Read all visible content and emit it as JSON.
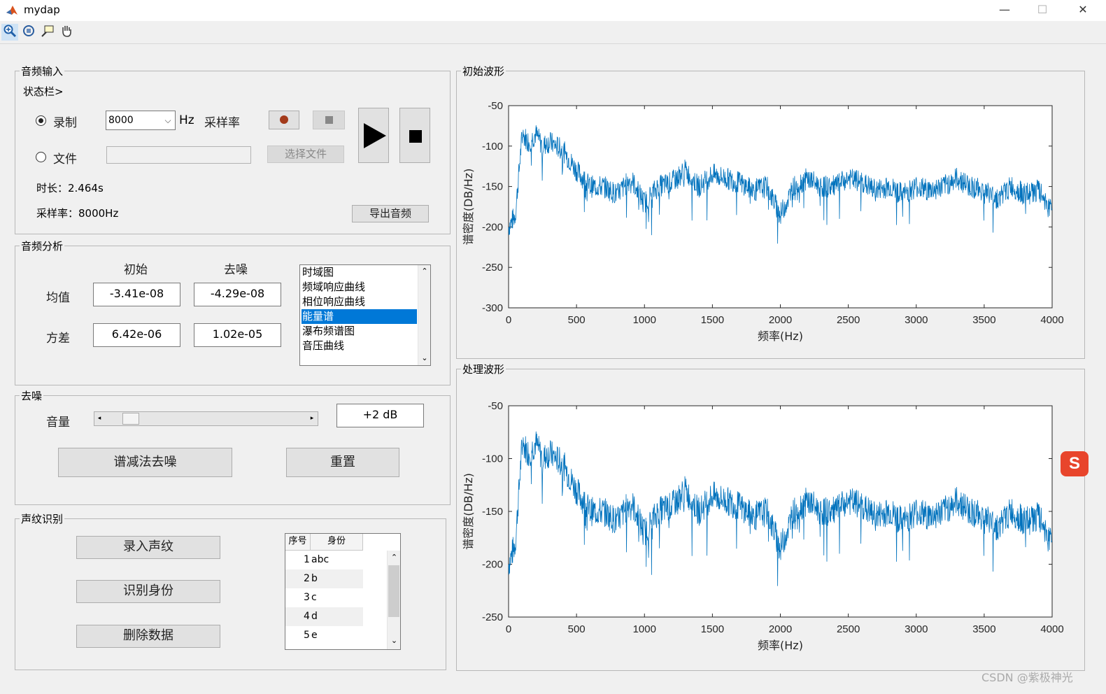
{
  "window": {
    "title": "mydap",
    "minimize_glyph": "—",
    "maximize_glyph": "☐",
    "close_glyph": "✕"
  },
  "toolbar": {
    "icons": [
      "zoom-in-icon",
      "rotate-icon",
      "data-cursor-icon",
      "pan-hand-icon"
    ]
  },
  "audio_input": {
    "title": "音频输入",
    "status": "状态栏>",
    "record_label": "录制",
    "sample_rate_value": "8000",
    "hz": "Hz",
    "sample_rate_label": "采样率",
    "file_label": "文件",
    "file_path_value": "",
    "choose_file": "选择文件",
    "duration": "时长：2.464s",
    "sample_rate_info": "采样率：8000Hz",
    "export": "导出音频"
  },
  "analysis": {
    "title": "音频分析",
    "col_initial": "初始",
    "col_denoised": "去噪",
    "row_mean": "均值",
    "row_variance": "方差",
    "mean_initial": "-3.41e-08",
    "mean_denoised": "-4.29e-08",
    "var_initial": "6.42e-06",
    "var_denoised": "1.02e-05",
    "plot_types": [
      "时域图",
      "频域响应曲线",
      "相位响应曲线",
      "能量谱",
      "瀑布频谱图",
      "音压曲线"
    ],
    "selected_plot_type": "能量谱"
  },
  "denoise": {
    "title": "去噪",
    "volume_label": "音量",
    "volume_level": 0.1,
    "volume_value": "+2 dB",
    "spectral_subtraction": "谱减法去噪",
    "reset": "重置"
  },
  "voiceprint": {
    "title": "声纹识别",
    "enroll": "录入声纹",
    "identify": "识别身份",
    "delete": "删除数据",
    "table_headers": [
      "序号",
      "身份"
    ],
    "rows": [
      {
        "id": "1",
        "name": "abc"
      },
      {
        "id": "2",
        "name": "b"
      },
      {
        "id": "3",
        "name": "c"
      },
      {
        "id": "4",
        "name": "d"
      },
      {
        "id": "5",
        "name": "e"
      }
    ]
  },
  "watermark": "CSDN @紫极神光",
  "chart_data": [
    {
      "type": "line",
      "panel_title": "初始波形",
      "xlabel": "频率(Hz)",
      "ylabel": "谱密度(DB/Hz)",
      "xlim": [
        0,
        4000
      ],
      "ylim": [
        -300,
        -50
      ],
      "x_ticks": [
        0,
        500,
        1000,
        1500,
        2000,
        2500,
        3000,
        3500,
        4000
      ],
      "y_ticks": [
        -50,
        -100,
        -150,
        -200,
        -250,
        -300
      ],
      "color": "#0072bd",
      "series": [
        {
          "x": [
            0,
            50,
            100,
            150,
            200,
            250,
            300,
            400,
            500,
            600,
            700,
            800,
            900,
            1000,
            1100,
            1200,
            1300,
            1400,
            1500,
            1600,
            1700,
            1800,
            1900,
            2000,
            2100,
            2200,
            2300,
            2400,
            2500,
            2600,
            2700,
            2800,
            2900,
            3000,
            3100,
            3200,
            3300,
            3400,
            3500,
            3600,
            3700,
            3800,
            3900,
            4000
          ],
          "values": [
            -200,
            -185,
            -85,
            -95,
            -85,
            -100,
            -95,
            -105,
            -130,
            -150,
            -150,
            -160,
            -140,
            -170,
            -150,
            -145,
            -130,
            -150,
            -135,
            -140,
            -145,
            -155,
            -150,
            -185,
            -150,
            -140,
            -150,
            -150,
            -140,
            -145,
            -155,
            -150,
            -160,
            -150,
            -155,
            -150,
            -140,
            -150,
            -155,
            -165,
            -150,
            -160,
            -155,
            -180
          ]
        }
      ]
    },
    {
      "type": "line",
      "panel_title": "处理波形",
      "xlabel": "频率(Hz)",
      "ylabel": "谱密度(DB/Hz)",
      "xlim": [
        0,
        4000
      ],
      "ylim": [
        -250,
        -50
      ],
      "x_ticks": [
        0,
        500,
        1000,
        1500,
        2000,
        2500,
        3000,
        3500,
        4000
      ],
      "y_ticks": [
        -50,
        -100,
        -150,
        -200,
        -250
      ],
      "color": "#0072bd",
      "series": [
        {
          "x": [
            0,
            50,
            100,
            150,
            200,
            250,
            300,
            400,
            500,
            600,
            700,
            800,
            900,
            1000,
            1100,
            1200,
            1300,
            1400,
            1500,
            1600,
            1700,
            1800,
            1900,
            2000,
            2100,
            2200,
            2300,
            2400,
            2500,
            2600,
            2700,
            2800,
            2900,
            3000,
            3100,
            3200,
            3300,
            3400,
            3500,
            3600,
            3700,
            3800,
            3900,
            4000
          ],
          "values": [
            -200,
            -180,
            -85,
            -95,
            -85,
            -100,
            -95,
            -105,
            -130,
            -150,
            -150,
            -160,
            -140,
            -170,
            -150,
            -145,
            -130,
            -150,
            -135,
            -140,
            -145,
            -155,
            -150,
            -185,
            -150,
            -140,
            -150,
            -150,
            -140,
            -145,
            -155,
            -150,
            -160,
            -150,
            -155,
            -150,
            -140,
            -150,
            -155,
            -165,
            -150,
            -160,
            -155,
            -180
          ]
        }
      ]
    }
  ]
}
